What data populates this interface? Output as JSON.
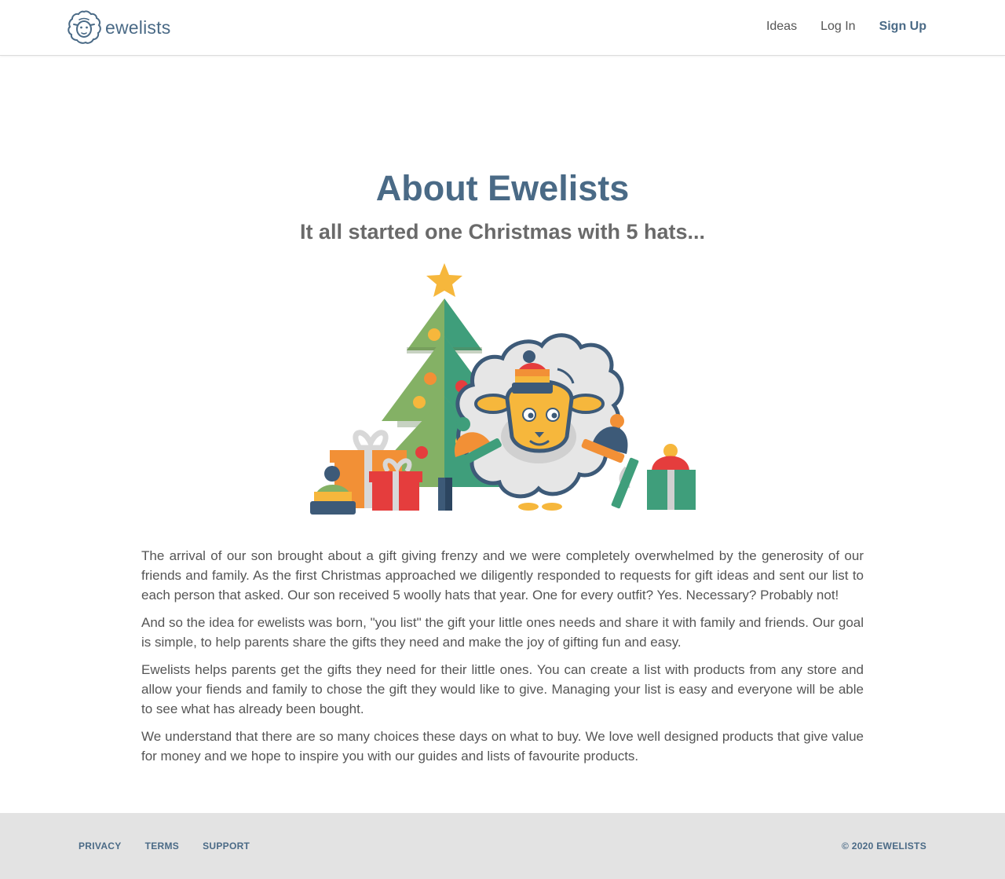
{
  "header": {
    "brand_name": "ewelists",
    "nav": {
      "ideas": "Ideas",
      "login": "Log In",
      "signup": "Sign Up"
    }
  },
  "main": {
    "title": "About Ewelists",
    "subtitle": "It all started one Christmas with 5 hats...",
    "paragraphs": [
      "The arrival of our son brought about a gift giving frenzy and we were completely overwhelmed by the generosity of our friends and family. As the first Christmas approached we diligently responded to requests for gift ideas and sent our list to each person that asked. Our son received 5 woolly hats that year. One for every outfit? Yes. Necessary? Probably not!",
      "And so the idea for ewelists was born, \"you list\" the gift your little ones needs and share it with family and friends. Our goal is simple, to help parents share the gifts they need and make the joy of gifting fun and easy.",
      "Ewelists helps parents get the gifts they need for their little ones. You can create a list with products from any store and allow your fiends and family to chose the gift they would like to give. Managing your list is easy and everyone will be able to see what has already been bought.",
      "We understand that there are so many choices these days on what to buy. We love well designed products that give value for money and we hope to inspire you with our guides and lists of favourite products."
    ]
  },
  "footer": {
    "privacy": "PRIVACY",
    "terms": "TERMS",
    "support": "SUPPORT",
    "copyright": "© 2020 EWELISTS"
  },
  "colors": {
    "brand": "#4a6a86",
    "footer_bg": "#e3e3e3"
  },
  "icons": {
    "logo": "sheep-logo-icon",
    "illustration": "christmas-sheep-illustration"
  }
}
